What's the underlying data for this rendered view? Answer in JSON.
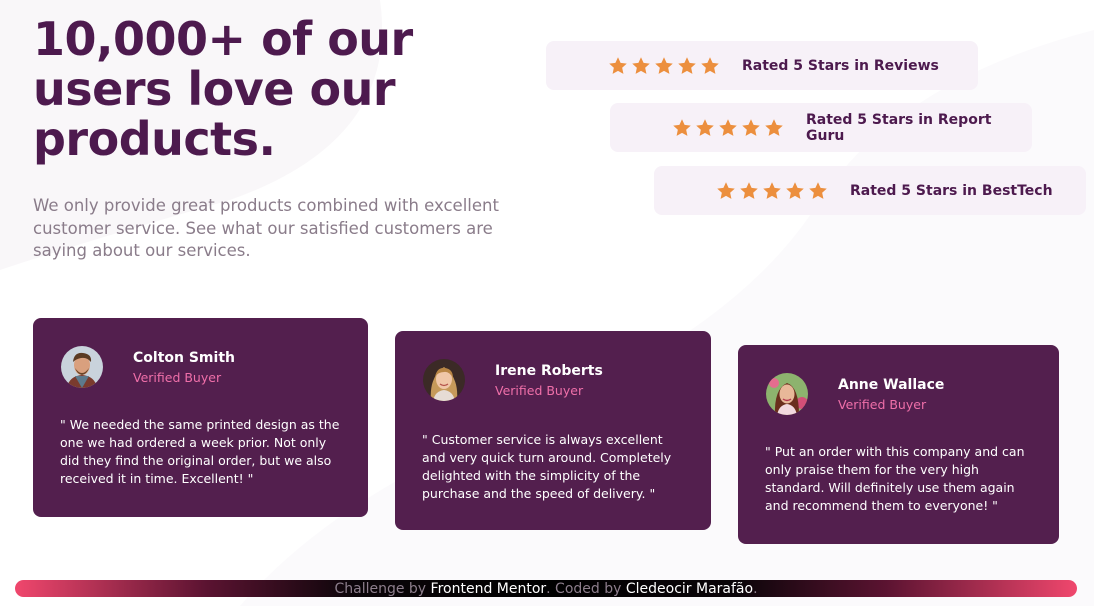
{
  "hero": {
    "title": "10,000+ of our users love our products.",
    "description": "We only provide great products combined with excellent customer service. See what our satisfied customers are saying about our services."
  },
  "ratings": [
    {
      "stars": 5,
      "label": "Rated 5 Stars in Reviews"
    },
    {
      "stars": 5,
      "label": "Rated 5 Stars in Report Guru"
    },
    {
      "stars": 5,
      "label": "Rated 5 Stars in BestTech"
    }
  ],
  "testimonials": [
    {
      "name": "Colton Smith",
      "role": "Verified Buyer",
      "quote": "\" We needed the same printed design as the one we had ordered a week prior. Not only did they find the original order, but we also received it in time. Excellent! \""
    },
    {
      "name": "Irene Roberts",
      "role": "Verified Buyer",
      "quote": "\" Customer service is always excellent and very quick turn around. Completely delighted with the simplicity of the purchase and the speed of delivery. \""
    },
    {
      "name": "Anne Wallace",
      "role": "Verified Buyer",
      "quote": "\" Put an order with this company and can only praise them for the very high standard. Will definitely use them again and recommend them to everyone! \""
    }
  ],
  "footer": {
    "prefix": "Challenge by ",
    "challenge_link": "Frontend Mentor",
    "middle": ". Coded by ",
    "author_link": "Cledeocir Marafão",
    "suffix": "."
  },
  "colors": {
    "primary": "#4d1a4e",
    "card_bg": "#531f4e",
    "star": "#ec8f3e",
    "accent_pink": "#ef6fa9",
    "rating_bg": "#f7f1f8"
  },
  "icons": {
    "rating_star": "star-icon"
  }
}
